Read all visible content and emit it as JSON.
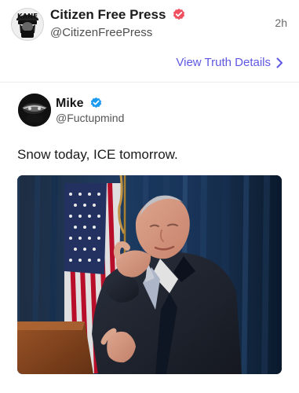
{
  "post": {
    "author_name": "Citizen Free Press",
    "author_handle": "@CitizenFreePress",
    "timestamp": "2h",
    "avatar_text": "KANE",
    "view_details_label": "View Truth Details",
    "icons": {
      "verified": "verified-badge-icon",
      "chevron": "chevron-right-icon"
    }
  },
  "quoted_post": {
    "author_name": "Mike",
    "author_handle": "@Fuctupmind",
    "text": "Snow today, ICE tomorrow.",
    "icons": {
      "verified": "verified-badge-icon"
    },
    "media": {
      "type": "photo"
    }
  },
  "colors": {
    "accent": "#5f58e3",
    "verified_primary": "#ef4f5e",
    "verified_quoted": "#1d9bf0"
  }
}
